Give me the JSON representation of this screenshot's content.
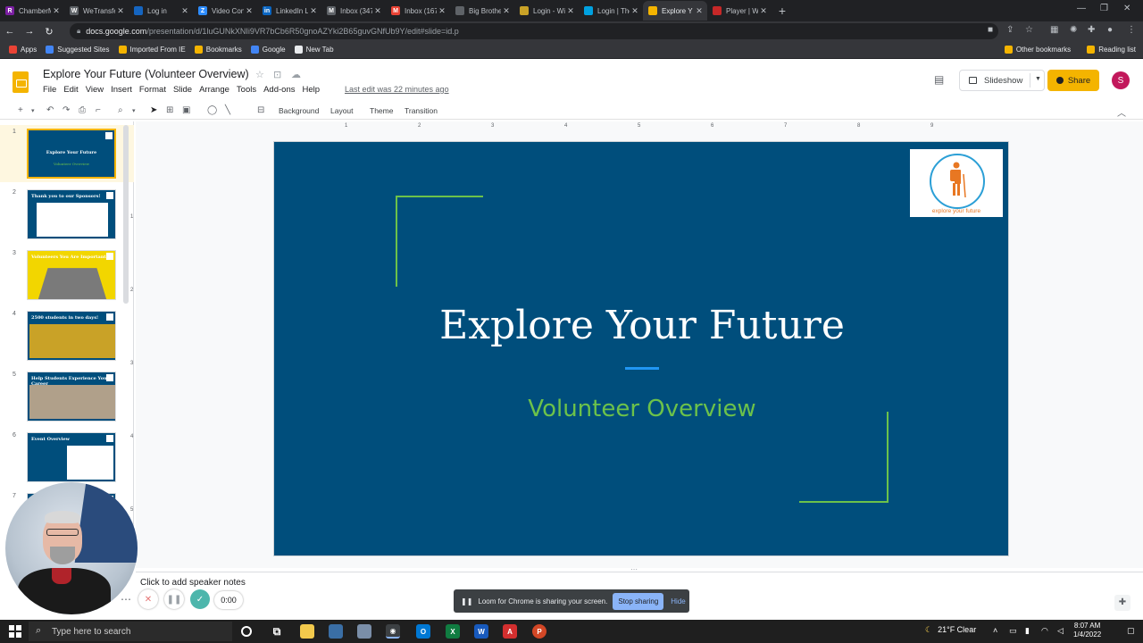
{
  "browser": {
    "tabs": [
      {
        "label": "ChamberMas",
        "color": "#7b1fa2",
        "glyph": "R"
      },
      {
        "label": "WeTransfer",
        "color": "#5f6368",
        "glyph": "W"
      },
      {
        "label": "Log in",
        "color": "#1565c0",
        "glyph": ""
      },
      {
        "label": "Video Confer",
        "color": "#2d8cff",
        "glyph": "Z"
      },
      {
        "label": "LinkedIn Log",
        "color": "#0a66c2",
        "glyph": "in"
      },
      {
        "label": "Inbox (347) -",
        "color": "#5f6368",
        "glyph": "M"
      },
      {
        "label": "Inbox (167) -",
        "color": "#ea4335",
        "glyph": "M"
      },
      {
        "label": "Big Brothers",
        "color": "#5f6368",
        "glyph": ""
      },
      {
        "label": "Login - Wisco",
        "color": "#c9a227",
        "glyph": ""
      },
      {
        "label": "Login | The A",
        "color": "#00a1e0",
        "glyph": ""
      },
      {
        "label": "Explore Y",
        "color": "#f4b400",
        "glyph": ""
      },
      {
        "label": "Player | WHB",
        "color": "#c62828",
        "glyph": ""
      }
    ],
    "url_host": "docs.google.com",
    "url_path": "/presentation/d/1luGUNkXNIi9VR7bCb6R50gnoAZYki2B65guvGNfUb9Y/edit#slide=id.p",
    "bookmarks": [
      "Apps",
      "Suggested Sites",
      "Imported From IE",
      "Bookmarks",
      "Google",
      "New Tab"
    ],
    "bookmarks_right": [
      "Other bookmarks",
      "Reading list"
    ]
  },
  "doc": {
    "title": "Explore Your Future (Volunteer Overview)",
    "menus": [
      "File",
      "Edit",
      "View",
      "Insert",
      "Format",
      "Slide",
      "Arrange",
      "Tools",
      "Add-ons",
      "Help"
    ],
    "last_edit": "Last edit was 22 minutes ago",
    "slideshow_label": "Slideshow",
    "share_label": "Share",
    "avatar_initial": "S"
  },
  "toolbar": {
    "background": "Background",
    "layout": "Layout",
    "theme": "Theme",
    "transition": "Transition"
  },
  "ruler": [
    "1",
    "2",
    "3",
    "4",
    "5",
    "6",
    "7",
    "8",
    "9"
  ],
  "vruler": [
    "1",
    "2",
    "3",
    "4",
    "5"
  ],
  "filmstrip": [
    {
      "num": "1",
      "title": "Explore Your Future",
      "subtitle": "Volunteer Overview",
      "bg": "#004e7c"
    },
    {
      "num": "2",
      "title": "Thank you to our Sponsors!",
      "subtitle": "",
      "bg": "#004e7c"
    },
    {
      "num": "3",
      "title": "Volunteers You Are Important",
      "subtitle": "",
      "bg": "#f2d600"
    },
    {
      "num": "4",
      "title": "2500 students in two days!",
      "subtitle": "",
      "bg": "#004e7c"
    },
    {
      "num": "5",
      "title": "Help Students Experience Your Career",
      "subtitle": "",
      "bg": "#004e7c"
    },
    {
      "num": "6",
      "title": "Event Overview",
      "subtitle": "",
      "bg": "#004e7c"
    },
    {
      "num": "7",
      "title": "",
      "subtitle": "",
      "bg": "#004e7c"
    }
  ],
  "slide": {
    "title": "Explore Your Future",
    "subtitle": "Volunteer Overview",
    "logo_text": "explore your future",
    "bg_color": "#004e7c",
    "accent_green": "#6cc24a",
    "accent_blue": "#2196f3"
  },
  "notes": {
    "placeholder": "Click to add speaker notes"
  },
  "loom": {
    "timer": "0:00",
    "share_message": "Loom for Chrome is sharing your screen.",
    "stop_label": "Stop sharing",
    "hide_label": "Hide"
  },
  "taskbar": {
    "search_placeholder": "Type here to search",
    "weather": "21°F  Clear",
    "time": "8:07 AM",
    "date": "1/4/2022"
  }
}
